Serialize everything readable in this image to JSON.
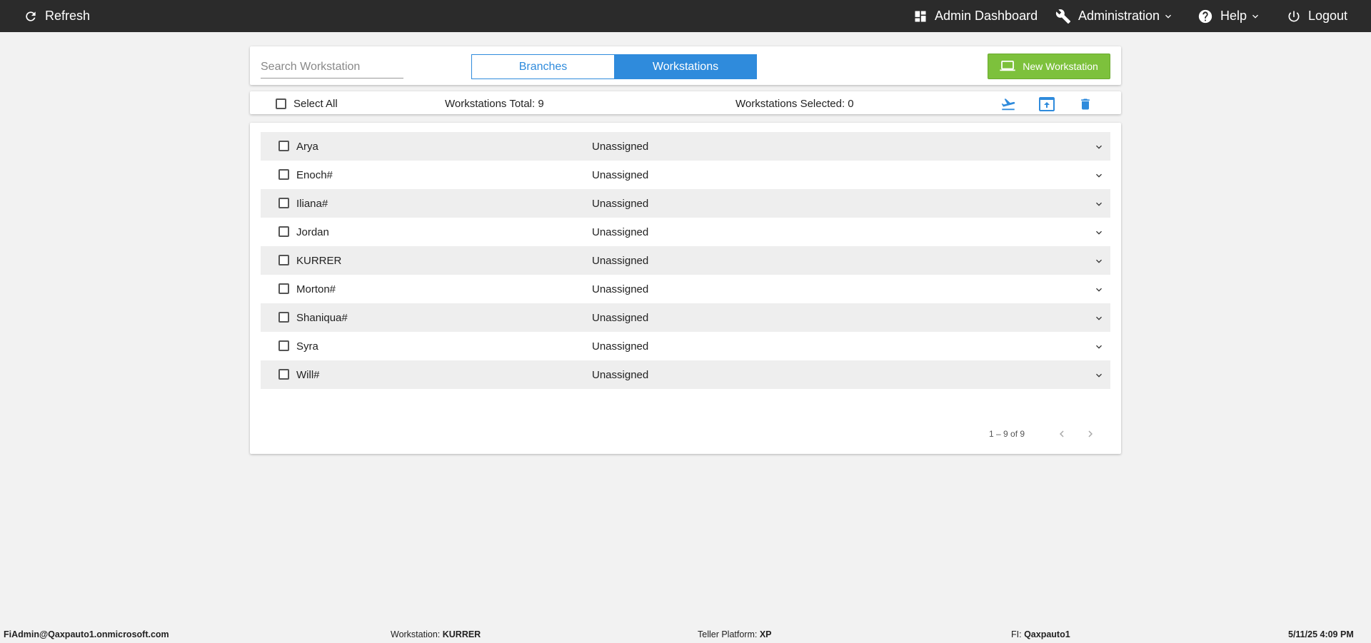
{
  "topbar": {
    "refresh": "Refresh",
    "admin_dashboard": "Admin Dashboard",
    "administration": "Administration",
    "help": "Help",
    "logout": "Logout"
  },
  "search": {
    "placeholder": "Search Workstation"
  },
  "tabs": {
    "branches": "Branches",
    "workstations": "Workstations"
  },
  "new_button": "New Workstation",
  "toolbar": {
    "select_all": "Select All",
    "total": "Workstations Total: 9",
    "selected": "Workstations Selected: 0"
  },
  "rows": [
    {
      "name": "Arya",
      "status": "Unassigned"
    },
    {
      "name": "Enoch#",
      "status": "Unassigned"
    },
    {
      "name": "Iliana#",
      "status": "Unassigned"
    },
    {
      "name": "Jordan",
      "status": "Unassigned"
    },
    {
      "name": "KURRER",
      "status": "Unassigned"
    },
    {
      "name": "Morton#",
      "status": "Unassigned"
    },
    {
      "name": "Shaniqua#",
      "status": "Unassigned"
    },
    {
      "name": "Syra",
      "status": "Unassigned"
    },
    {
      "name": "Will#",
      "status": "Unassigned"
    }
  ],
  "pager": {
    "range": "1 – 9 of 9"
  },
  "footer": {
    "user": "FiAdmin@Qaxpauto1.onmicrosoft.com",
    "workstation_label": "Workstation:",
    "workstation_value": "KURRER",
    "platform_label": "Teller Platform:",
    "platform_value": "XP",
    "fi_label": "FI:",
    "fi_value": "Qaxpauto1",
    "datetime": "5/11/25 4:09 PM"
  },
  "colors": {
    "accent": "#2f8bdc",
    "new_button": "#7dc13c",
    "topbar": "#2b2b2b"
  },
  "icons": [
    "refresh-icon",
    "dashboard-icon",
    "wrench-icon",
    "help-icon",
    "power-icon",
    "laptop-icon",
    "plane-icon",
    "upload-icon",
    "trash-icon",
    "chevron-down-icon",
    "chevron-left-icon",
    "chevron-right-icon"
  ]
}
